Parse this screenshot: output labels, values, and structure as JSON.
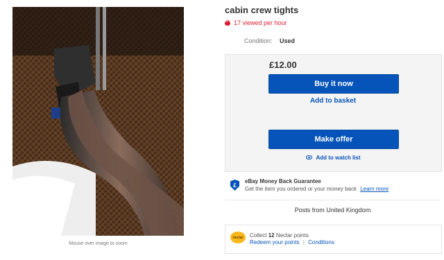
{
  "listing": {
    "title": "cabin crew tights",
    "viewed": "17 viewed per hour",
    "condition_label": "Condition:",
    "condition_value": "Used",
    "zoom_hint": "Mouse over image to zoom"
  },
  "buy_box": {
    "price": "£12.00",
    "buy_now_label": "Buy it now",
    "add_to_basket_label": "Add to basket",
    "make_offer_label": "Make offer",
    "watch_label": "Add to watch list"
  },
  "guarantee": {
    "title": "eBay Money Back Guarantee",
    "text": "Get the item you ordered or your money back",
    "learn_more": "Learn more"
  },
  "shipping": {
    "posts_from": "Posts from United Kingdom"
  },
  "nectar": {
    "collect_prefix": "Collect",
    "points": "12",
    "collect_suffix": "Nectar points",
    "redeem_label": "Redeem your points",
    "separator": "|",
    "conditions_label": "Conditions",
    "logo_text": "nectar"
  },
  "colors": {
    "accent": "#0654ba",
    "alert": "#dd1e31",
    "panel": "#f4f4f4"
  }
}
